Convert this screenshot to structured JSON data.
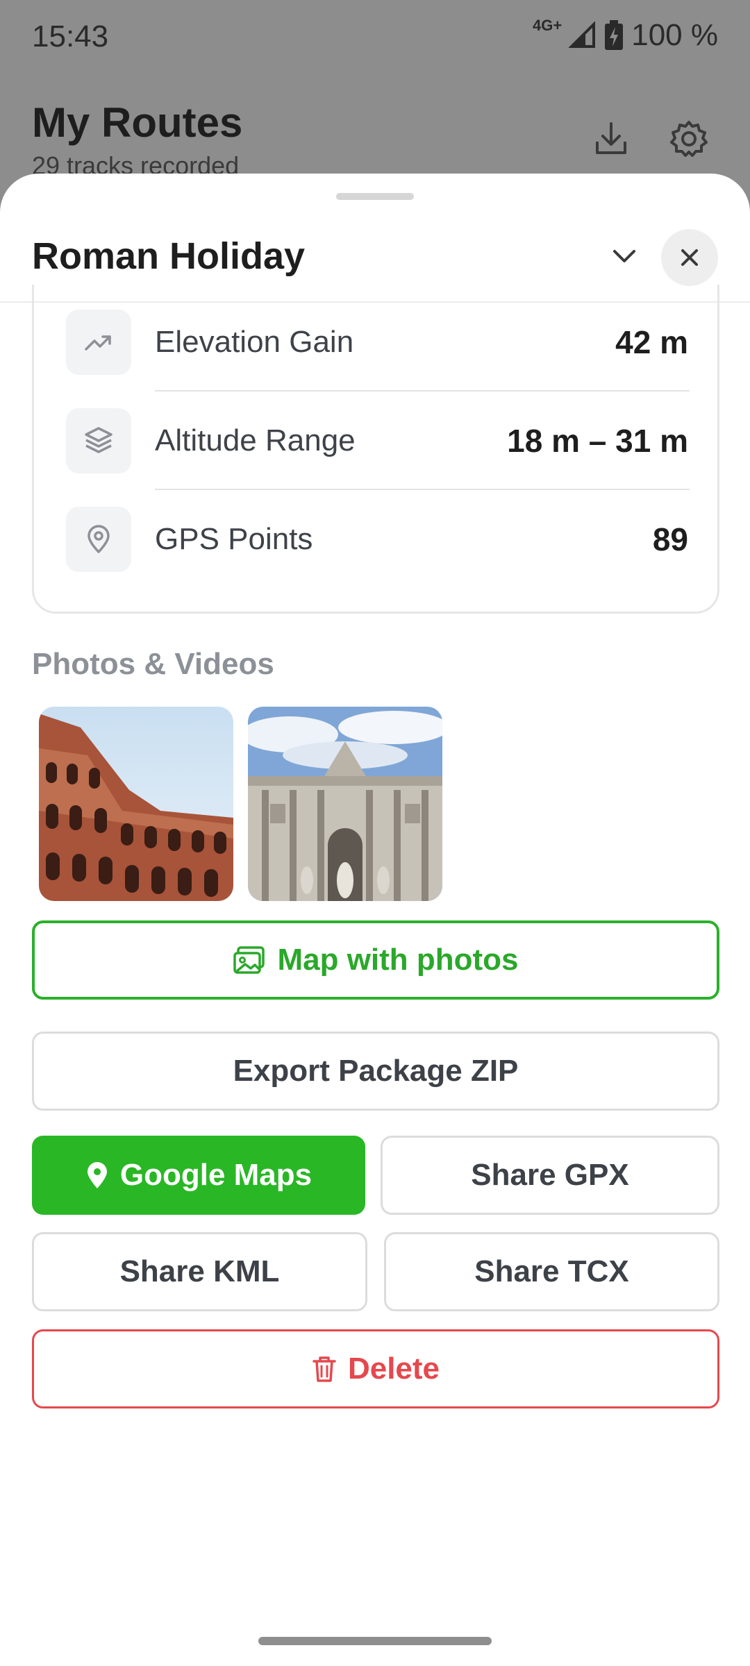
{
  "status_bar": {
    "time": "15:43",
    "network": "4G+",
    "battery": "100 %"
  },
  "background": {
    "title": "My Routes",
    "subtitle": "29 tracks recorded",
    "icons": [
      "download-icon",
      "gear-icon"
    ]
  },
  "sheet": {
    "title": "Roman Holiday",
    "stats": [
      {
        "icon": "trending-up-icon",
        "label": "Elevation Gain",
        "value": "42 m"
      },
      {
        "icon": "layers-icon",
        "label": "Altitude Range",
        "value": "18 m – 31 m"
      },
      {
        "icon": "location-pin-icon",
        "label": "GPS Points",
        "value": "89"
      }
    ],
    "media_section_title": "Photos & Videos",
    "photos": [
      "colosseum-photo",
      "trevi-fountain-photo"
    ],
    "buttons": {
      "map_with_photos": "Map with photos",
      "export_zip": "Export Package ZIP",
      "google_maps": "Google Maps",
      "share_gpx": "Share GPX",
      "share_kml": "Share KML",
      "share_tcx": "Share TCX",
      "delete": "Delete"
    }
  },
  "colors": {
    "accent_green": "#29b725",
    "danger_red": "#e5484d",
    "muted_text": "#8c9097"
  }
}
